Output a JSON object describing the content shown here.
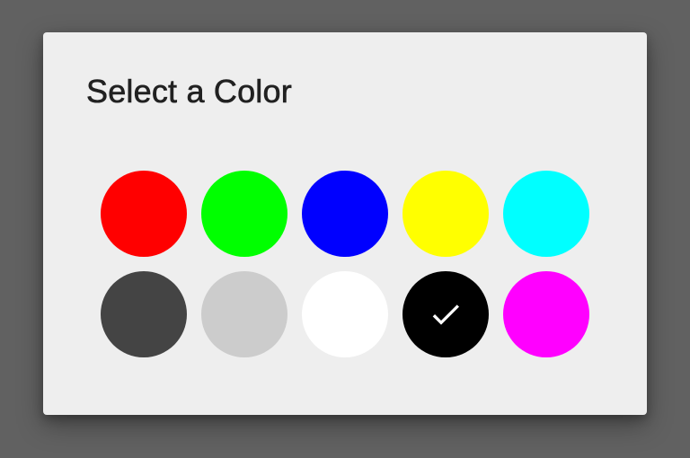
{
  "dialog": {
    "title": "Select a Color"
  },
  "swatches": [
    {
      "name": "red",
      "color": "#ff0000",
      "selected": false
    },
    {
      "name": "green",
      "color": "#00ff00",
      "selected": false
    },
    {
      "name": "blue",
      "color": "#0000ff",
      "selected": false
    },
    {
      "name": "yellow",
      "color": "#ffff00",
      "selected": false
    },
    {
      "name": "cyan",
      "color": "#00ffff",
      "selected": false
    },
    {
      "name": "dark-gray",
      "color": "#444444",
      "selected": false
    },
    {
      "name": "light-gray",
      "color": "#cccccc",
      "selected": false
    },
    {
      "name": "white",
      "color": "#ffffff",
      "selected": false
    },
    {
      "name": "black",
      "color": "#000000",
      "selected": true
    },
    {
      "name": "magenta",
      "color": "#ff00ff",
      "selected": false
    }
  ],
  "icons": {
    "selected_marker": "check-icon"
  },
  "colors": {
    "backdrop": "#616161",
    "dialog_background": "#eeeeee",
    "title_text": "#212121",
    "check_mark": "#ffffff"
  }
}
